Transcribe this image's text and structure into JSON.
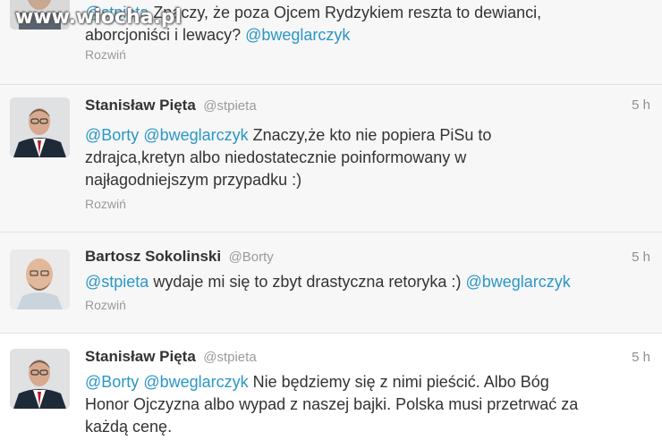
{
  "watermark": "www.wiocha.pl",
  "tweets": [
    {
      "name": "",
      "handle": "",
      "time": "",
      "text_line1_mention": "@stpieta",
      "text_line1_rest": " Znaczy, że poza Ojcem Rydzykiem reszta to dewianci,",
      "text_line2_rest": "aborcjoniści i lewacy? ",
      "text_line2_mention": "@bweglarczyk",
      "expand": "Rozwiń",
      "avatar": "man-portrait-avatar"
    },
    {
      "name": "Stanisław Pięta",
      "handle": "@stpieta",
      "time": "5 h",
      "mention1": "@Borty",
      "mention2": "@bweglarczyk",
      "line1_rest": " Znaczy,że kto nie popiera PiSu to",
      "line2": "zdrajca,kretyn albo niedostatecznie poinformowany w",
      "line3": "najłagodniejszym przypadku :)",
      "expand": "Rozwiń",
      "avatar": "man-in-suit-avatar"
    },
    {
      "name": "Bartosz Sokolinski",
      "handle": "@Borty",
      "time": "5 h",
      "mention1": "@stpieta",
      "line1_rest": " wydaje mi się to zbyt drastyczna retoryka :) ",
      "mention2": "@bweglarczyk",
      "expand": "Rozwiń",
      "avatar": "smiling-bald-man-avatar"
    },
    {
      "name": "Stanisław Pięta",
      "handle": "@stpieta",
      "time": "5 h",
      "mention1": "@Borty",
      "mention2": "@bweglarczyk",
      "line1_rest": " Nie będziemy się z nimi pieścić. Albo Bóg",
      "line2": "Honor Ojczyzna albo wypad z naszej bajki. Polska musi przetrwać za",
      "line3": "każdą cenę.",
      "avatar": "man-in-suit-avatar"
    }
  ],
  "colors": {
    "mention": "#2a97c7",
    "name": "#333333",
    "meta": "#9a9a9a",
    "background": "#f7f7f7"
  }
}
